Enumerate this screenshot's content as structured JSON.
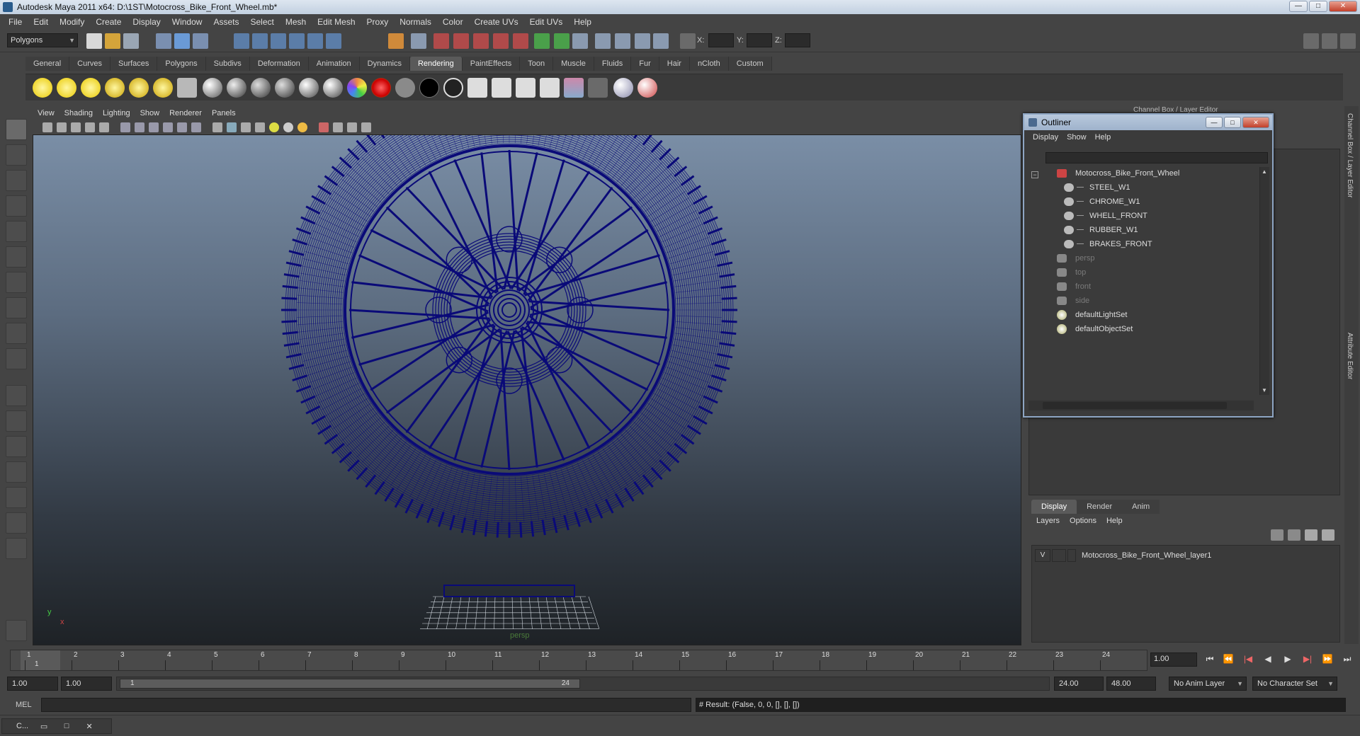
{
  "window": {
    "title": "Autodesk Maya 2011 x64: D:\\1ST\\Motocross_Bike_Front_Wheel.mb*",
    "buttons": [
      "—",
      "□",
      "✕"
    ]
  },
  "menubar": [
    "File",
    "Edit",
    "Modify",
    "Create",
    "Display",
    "Window",
    "Assets",
    "Select",
    "Mesh",
    "Edit Mesh",
    "Proxy",
    "Normals",
    "Color",
    "Create UVs",
    "Edit UVs",
    "Help"
  ],
  "statusline": {
    "mode": "Polygons",
    "x_label": "X:",
    "y_label": "Y:",
    "z_label": "Z:"
  },
  "shelf": {
    "tabs": [
      "General",
      "Curves",
      "Surfaces",
      "Polygons",
      "Subdivs",
      "Deformation",
      "Animation",
      "Dynamics",
      "Rendering",
      "PaintEffects",
      "Toon",
      "Muscle",
      "Fluids",
      "Fur",
      "Hair",
      "nCloth",
      "Custom"
    ],
    "active_tab": "Rendering"
  },
  "viewport": {
    "menu": [
      "View",
      "Shading",
      "Lighting",
      "Show",
      "Renderer",
      "Panels"
    ],
    "camera_label": "persp",
    "axis_x": "x",
    "axis_y": "y",
    "wire_color": "#0a0a78"
  },
  "channel_box": {
    "title": "Channel Box / Layer Editor",
    "side_tabs": [
      "Channel Box / Layer Editor",
      "Attribute Editor"
    ]
  },
  "outliner": {
    "title": "Outliner",
    "menu": [
      "Display",
      "Show",
      "Help"
    ],
    "items": [
      {
        "label": "Motocross_Bike_Front_Wheel",
        "dim": false
      },
      {
        "label": "STEEL_W1",
        "dim": false
      },
      {
        "label": "CHROME_W1",
        "dim": false
      },
      {
        "label": "WHELL_FRONT",
        "dim": false
      },
      {
        "label": "RUBBER_W1",
        "dim": false
      },
      {
        "label": "BRAKES_FRONT",
        "dim": false
      },
      {
        "label": "persp",
        "dim": true
      },
      {
        "label": "top",
        "dim": true
      },
      {
        "label": "front",
        "dim": true
      },
      {
        "label": "side",
        "dim": true
      },
      {
        "label": "defaultLightSet",
        "dim": false
      },
      {
        "label": "defaultObjectSet",
        "dim": false
      }
    ]
  },
  "layer_editor": {
    "tabs": [
      "Display",
      "Render",
      "Anim"
    ],
    "active_tab": "Display",
    "menu": [
      "Layers",
      "Options",
      "Help"
    ],
    "layer": {
      "visible": "V",
      "name": "Motocross_Bike_Front_Wheel_layer1"
    }
  },
  "timeline": {
    "ticks": [
      "1",
      "2",
      "3",
      "4",
      "5",
      "6",
      "7",
      "8",
      "9",
      "10",
      "11",
      "12",
      "13",
      "14",
      "15",
      "16",
      "17",
      "18",
      "19",
      "20",
      "21",
      "22",
      "23",
      "24"
    ],
    "current_frame_label": "1",
    "current_time": "1.00"
  },
  "range": {
    "start_time": "1.00",
    "playback_start": "1.00",
    "range_start_label": "1",
    "range_end_label": "24",
    "playback_end": "24.00",
    "end_time": "48.00",
    "anim_layer": "No Anim Layer",
    "character_set": "No Character Set"
  },
  "command_line": {
    "label": "MEL",
    "result": "# Result: (False, 0, 0, [], [], [])"
  },
  "minimized_window": {
    "label": "C..."
  }
}
